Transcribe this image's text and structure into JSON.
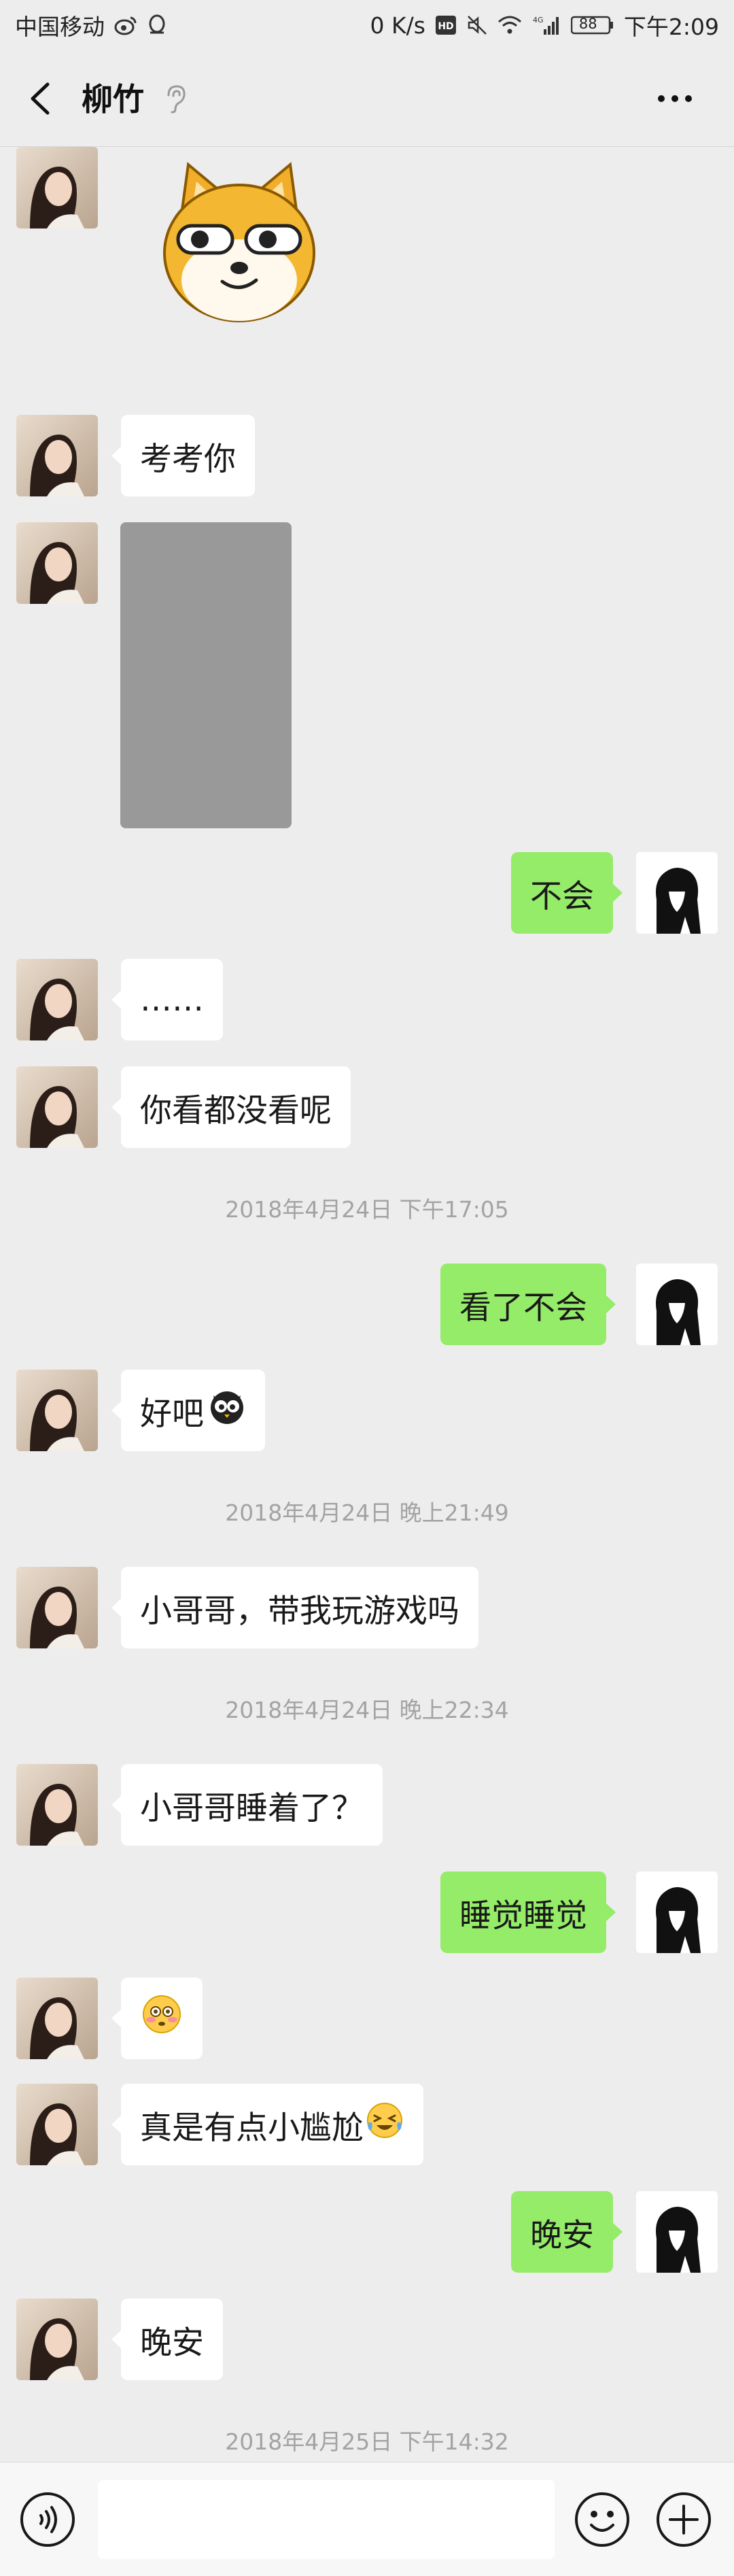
{
  "status_bar": {
    "carrier": "中国移动",
    "speed": "0 K/s",
    "network": "4G",
    "battery": "88",
    "time": "下午2:09"
  },
  "header": {
    "title": "柳竹",
    "icons": {
      "back": "chevron-left-icon",
      "earpiece": "ear-icon",
      "more": "more-dots-icon"
    }
  },
  "messages": {
    "m1": {
      "side": "left",
      "type": "sticker",
      "sticker": "shiba-doge-sticker"
    },
    "m2": {
      "side": "left",
      "text": "考考你"
    },
    "m3": {
      "side": "left",
      "type": "image",
      "placeholder_color": "#999999"
    },
    "m4": {
      "side": "right",
      "text": "不会"
    },
    "m5": {
      "side": "left",
      "text": "……"
    },
    "m6": {
      "side": "left",
      "text": "你看都没看呢"
    },
    "t1": "2018年4月24日 下午17:05",
    "m7": {
      "side": "right",
      "text": "看了不会"
    },
    "m8": {
      "side": "left",
      "text": "好吧",
      "emoji": "owl-emoji"
    },
    "t2": "2018年4月24日 晚上21:49",
    "m9": {
      "side": "left",
      "text": "小哥哥，带我玩游戏吗"
    },
    "t3": "2018年4月24日 晚上22:34",
    "m10": {
      "side": "left",
      "text": "小哥哥睡着了？"
    },
    "m11": {
      "side": "right",
      "text": "睡觉睡觉"
    },
    "m12": {
      "side": "left",
      "type": "emoji",
      "emoji": "flushed-face-emoji"
    },
    "m13": {
      "side": "left",
      "text": "真是有点小尴尬",
      "emoji": "laughing-crying-emoji"
    },
    "m14": {
      "side": "right",
      "text": "晚安"
    },
    "m15": {
      "side": "left",
      "text": "晚安"
    },
    "t4": "2018年4月25日 下午14:32"
  },
  "input_bar": {
    "placeholder": "",
    "icons": {
      "voice": "voice-icon",
      "emoji": "emoji-face-icon",
      "plus": "plus-circle-icon"
    }
  },
  "colors": {
    "background": "#ededed",
    "bubble_left": "#ffffff",
    "bubble_right": "#95ec69",
    "timestamp": "#a3a3a3"
  }
}
